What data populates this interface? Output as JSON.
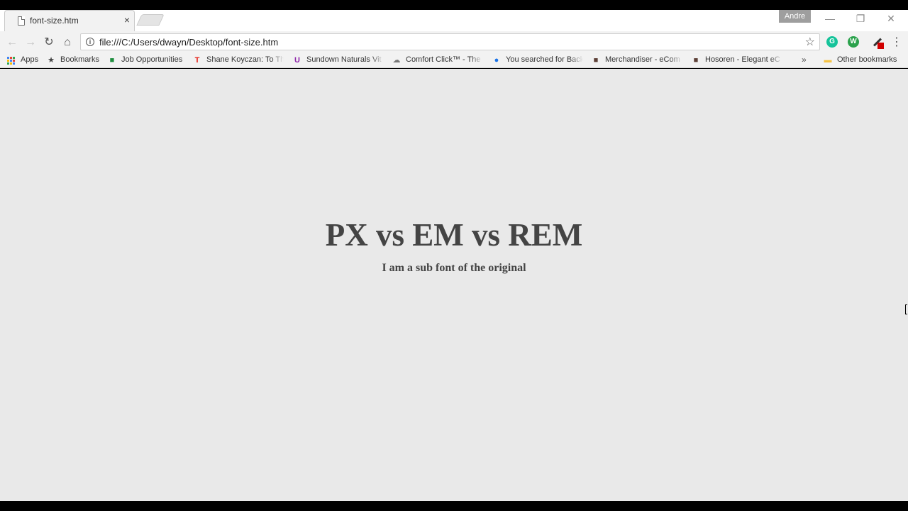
{
  "tab": {
    "title": "font-size.htm",
    "close_glyph": "×"
  },
  "profile": {
    "name": "Andre"
  },
  "window": {
    "minimize": "—",
    "restore": "❐",
    "close": "✕"
  },
  "toolbar": {
    "back": "←",
    "forward": "→",
    "reload": "↻",
    "home": "⌂",
    "url": "file:///C:/Users/dwayn/Desktop/font-size.htm",
    "info": "i",
    "star": "☆",
    "extensions": [
      {
        "name": "grammarly-extension",
        "glyph": "G",
        "color": "#15c39a"
      },
      {
        "name": "w-extension",
        "glyph": "W",
        "color": "#2ba24c"
      },
      {
        "name": "pen-extension",
        "color": "#d10000"
      }
    ],
    "menu": "⋮"
  },
  "bookmarks": {
    "items": [
      {
        "label": "Apps",
        "icon": "apps-grid-icon"
      },
      {
        "label": "Bookmarks",
        "icon": "star-icon",
        "glyph": "★",
        "color": "#444444"
      },
      {
        "label": "Job Opportunities",
        "icon": "green-square-icon",
        "glyph": "■",
        "color": "#1e8e3e"
      },
      {
        "label": "Shane Koyczan: To Th",
        "icon": "red-t-icon",
        "glyph": "T",
        "color": "#e62117"
      },
      {
        "label": "Sundown Naturals Vit",
        "icon": "purple-u-icon",
        "glyph": "U",
        "color": "#8e24aa"
      },
      {
        "label": "Comfort Click™ - The",
        "icon": "cloud-icon",
        "glyph": "☁",
        "color": "#777777"
      },
      {
        "label": "You searched for Back",
        "icon": "blue-circle-icon",
        "glyph": "●",
        "color": "#1a73e8"
      },
      {
        "label": "Merchandiser - eCom",
        "icon": "brown-square-icon",
        "glyph": "■",
        "color": "#5d4037"
      },
      {
        "label": "Hosoren - Elegant eC",
        "icon": "brown-square-icon",
        "glyph": "■",
        "color": "#5d4037"
      }
    ],
    "overflow": "»",
    "other": {
      "label": "Other bookmarks",
      "icon": "folder-icon",
      "glyph": "▬",
      "color": "#f6c343"
    }
  },
  "page": {
    "heading": "PX vs EM vs REM",
    "subheading": "I am a sub font of the original"
  }
}
